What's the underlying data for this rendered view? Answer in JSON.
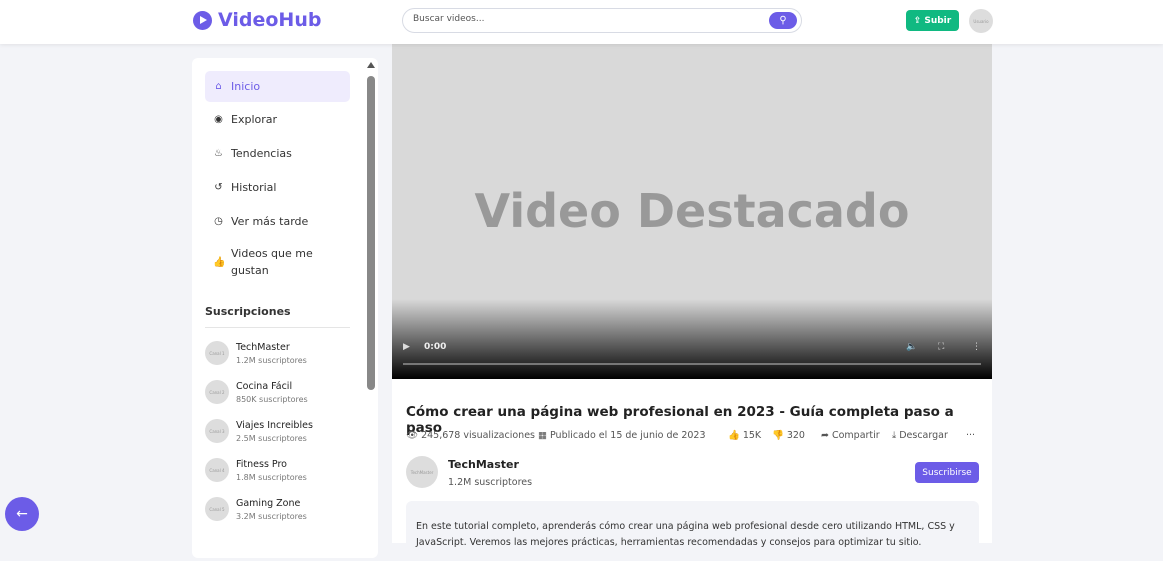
{
  "header": {
    "brand": "VideoHub",
    "search_placeholder": "Buscar videos...",
    "upload_label": "Subir",
    "user_avatar": "Usuario"
  },
  "sidebar": {
    "items": [
      {
        "label": "Inicio",
        "icon": "home-icon"
      },
      {
        "label": "Explorar",
        "icon": "compass-icon"
      },
      {
        "label": "Tendencias",
        "icon": "fire-icon"
      },
      {
        "label": "Historial",
        "icon": "history-icon"
      },
      {
        "label": "Ver más tarde",
        "icon": "clock-icon"
      },
      {
        "label": "Videos que me gustan",
        "icon": "thumbs-up-icon"
      }
    ],
    "subs_title": "Suscripciones",
    "subscriptions": [
      {
        "avatar": "Canal 1",
        "name": "TechMaster",
        "count": "1.2M suscriptores"
      },
      {
        "avatar": "Canal 2",
        "name": "Cocina Fácil",
        "count": "850K suscriptores"
      },
      {
        "avatar": "Canal 3",
        "name": "Viajes Increibles",
        "count": "2.5M suscriptores"
      },
      {
        "avatar": "Canal 4",
        "name": "Fitness Pro",
        "count": "1.8M suscriptores"
      },
      {
        "avatar": "Canal 5",
        "name": "Gaming Zone",
        "count": "3.2M suscriptores"
      }
    ]
  },
  "video": {
    "placeholder": "Video Destacado",
    "time": "0:00"
  },
  "info": {
    "title": "Cómo crear una página web profesional en 2023 - Guía completa paso a paso",
    "views": "245,678 visualizaciones",
    "published": "Publicado el 15 de junio de 2023",
    "likes": "15K",
    "dislikes": "320",
    "share": "Compartir",
    "download": "Descargar",
    "more": "···"
  },
  "channel": {
    "avatar": "TechMaster",
    "name": "TechMaster",
    "subs": "1.2M suscriptores",
    "subscribe": "Suscribirse"
  },
  "description": "En este tutorial completo, aprenderás cómo crear una página web profesional desde cero utilizando HTML, CSS y JavaScript. Veremos las mejores prácticas, herramientas recomendadas y consejos para optimizar tu sitio."
}
